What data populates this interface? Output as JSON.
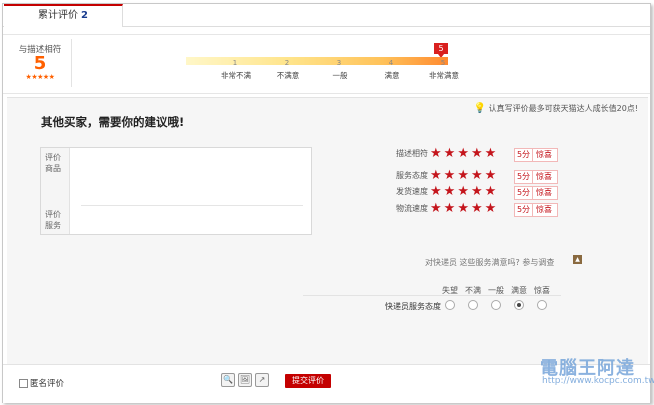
{
  "tab": {
    "label": "累计评价",
    "count": "2"
  },
  "summary": {
    "title": "与描述相符",
    "score": "5",
    "stars": "★★★★★",
    "marker": "5",
    "ticks": [
      "1",
      "2",
      "3",
      "4",
      "5"
    ],
    "labels": [
      "非常不满",
      "不满意",
      "一般",
      "满意",
      "非常满意"
    ]
  },
  "form": {
    "tip": "认真写评价最多可获天猫达人成长值20点!",
    "heading": "其他买家，需要你的建议哦!",
    "comment_labels": {
      "product_1": "评价",
      "product_2": "商品",
      "service_1": "评价",
      "service_2": "服务"
    },
    "ratings": [
      {
        "label": "描述相符",
        "points": "5分",
        "text": "惊喜"
      },
      {
        "label": "服务态度",
        "points": "5分",
        "text": "惊喜"
      },
      {
        "label": "发货速度",
        "points": "5分",
        "text": "惊喜"
      },
      {
        "label": "物流速度",
        "points": "5分",
        "text": "惊喜"
      }
    ],
    "survey": "对快递员  这些服务满意吗? 参与调查",
    "options": [
      "失望",
      "不满",
      "一般",
      "满意",
      "惊喜"
    ],
    "satisfaction_label": "快递员服务态度",
    "selected_option": "满意"
  },
  "bottom": {
    "anonymous_label": "匿名评价",
    "submit_label": "提交评价"
  },
  "watermark": {
    "line1": "電腦王阿達",
    "line2": "http://www.kocpc.com.tw"
  }
}
